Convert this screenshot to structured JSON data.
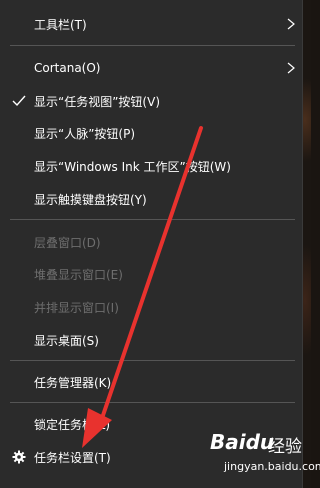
{
  "menu": {
    "items": [
      {
        "label": "工具栏(T)",
        "has_submenu": true,
        "checked": false,
        "disabled": false
      },
      {
        "label": "Cortana(O)",
        "has_submenu": true,
        "checked": false,
        "disabled": false
      },
      {
        "label": "显示“任务视图”按钮(V)",
        "has_submenu": false,
        "checked": true,
        "disabled": false
      },
      {
        "label": "显示“人脉”按钮(P)",
        "has_submenu": false,
        "checked": false,
        "disabled": false
      },
      {
        "label": "显示“Windows Ink 工作区”按钮(W)",
        "has_submenu": false,
        "checked": false,
        "disabled": false
      },
      {
        "label": "显示触摸键盘按钮(Y)",
        "has_submenu": false,
        "checked": false,
        "disabled": false
      },
      {
        "label": "层叠窗口(D)",
        "has_submenu": false,
        "checked": false,
        "disabled": true
      },
      {
        "label": "堆叠显示窗口(E)",
        "has_submenu": false,
        "checked": false,
        "disabled": true
      },
      {
        "label": "并排显示窗口(I)",
        "has_submenu": false,
        "checked": false,
        "disabled": true
      },
      {
        "label": "显示桌面(S)",
        "has_submenu": false,
        "checked": false,
        "disabled": false
      },
      {
        "label": "任务管理器(K)",
        "has_submenu": false,
        "checked": false,
        "disabled": false
      },
      {
        "label": "锁定任务栏(L)",
        "has_submenu": false,
        "checked": false,
        "disabled": false
      },
      {
        "label": "任务栏设置(T)",
        "has_submenu": false,
        "checked": false,
        "disabled": false,
        "icon": "gear-icon"
      }
    ]
  },
  "colors": {
    "menu_bg": "#2b2b2b",
    "text": "#ffffff",
    "disabled_text": "#6e6e6e",
    "separator": "#555555",
    "annotation_arrow": "#e8322e"
  },
  "watermark": {
    "logo": "Baidu",
    "logo_suffix": "经验",
    "url": "jingyan.baidu.com"
  }
}
